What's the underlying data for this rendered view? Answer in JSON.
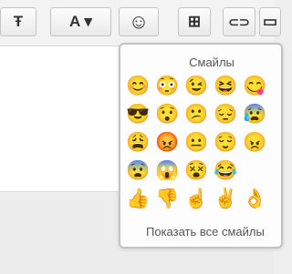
{
  "toolbar": {
    "buttons": [
      {
        "name": "strikethrough-button",
        "glyph": "Ŧ"
      },
      {
        "name": "font-color-button",
        "glyph": "A ▾"
      },
      {
        "name": "emoji-button",
        "glyph": "☺"
      },
      {
        "name": "table-button",
        "glyph": "⊞"
      },
      {
        "name": "link-button",
        "glyph": "⊂⊃"
      },
      {
        "name": "image-button",
        "glyph": "▭"
      }
    ]
  },
  "smileys_popup": {
    "title": "Смайлы",
    "show_all": "Показать все смайлы",
    "emojis": [
      "😊",
      "😳",
      "😉",
      "😆",
      "😋",
      "😎",
      "😯",
      "😕",
      "😔",
      "😰",
      "😩",
      "😡",
      "😐",
      "😌",
      "😠",
      "😨",
      "😱",
      "😵",
      "😂",
      "",
      "👍",
      "👎",
      "☝",
      "✌",
      "👌"
    ]
  }
}
